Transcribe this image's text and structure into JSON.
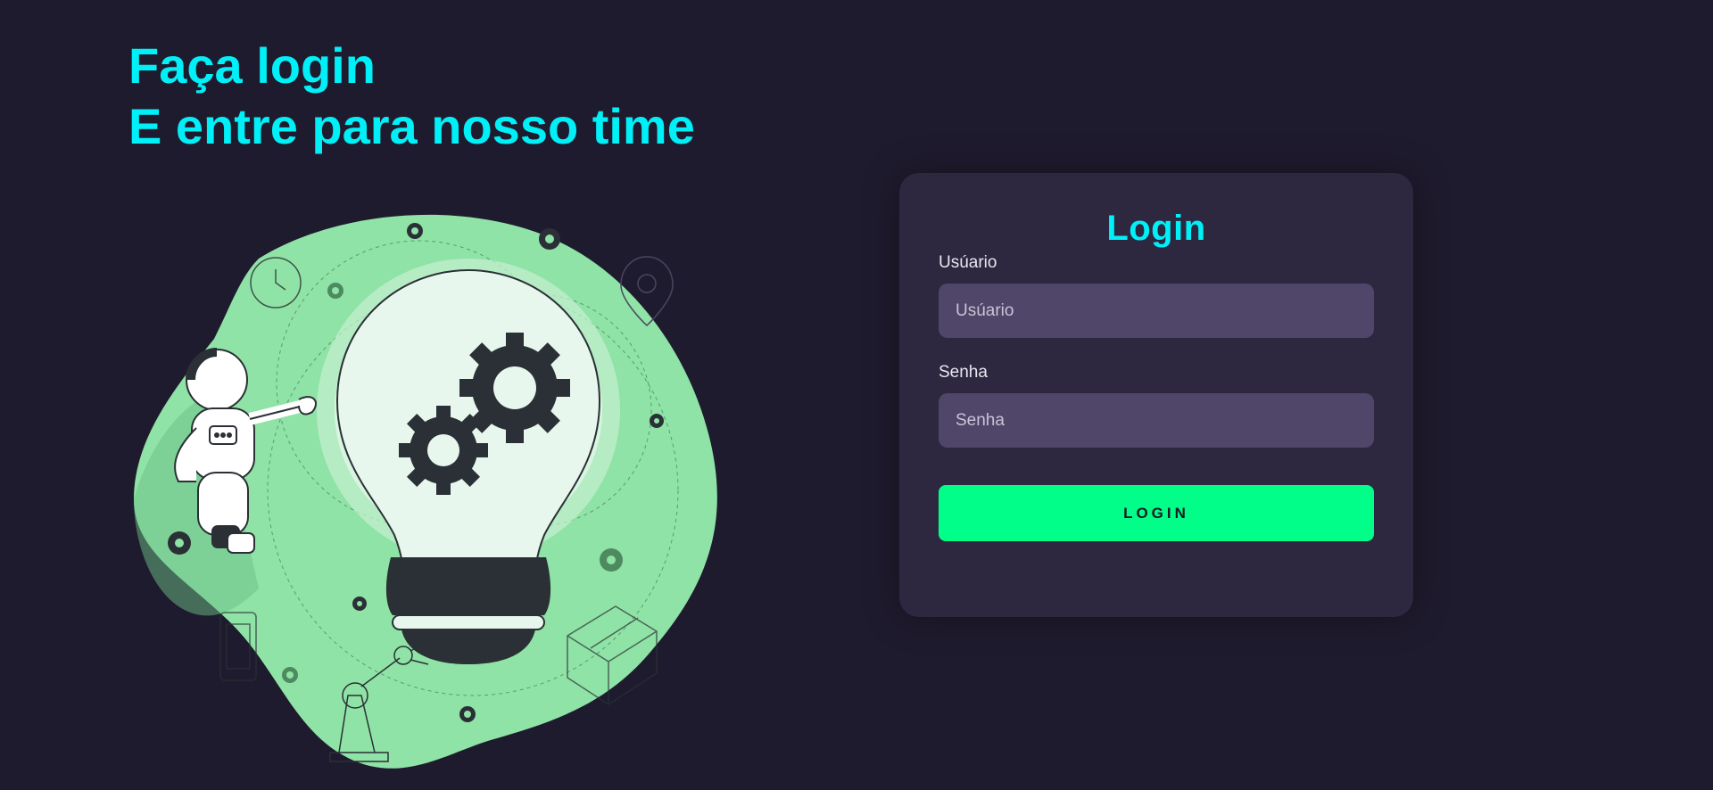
{
  "hero": {
    "line1": "Faça login",
    "line2": "E entre para nosso time"
  },
  "login_card": {
    "title": "Login",
    "username": {
      "label": "Usúario",
      "placeholder": "Usúario",
      "value": ""
    },
    "password": {
      "label": "Senha",
      "placeholder": "Senha",
      "value": ""
    },
    "submit_label": "LOGIN"
  },
  "illustration": {
    "subject": "astronaut-with-lightbulb-and-gears",
    "icons": [
      "gear-icon",
      "lightbulb-icon",
      "astronaut-icon",
      "clock-icon",
      "map-pin-icon",
      "smartphone-icon",
      "robot-arm-icon",
      "box-icon"
    ]
  },
  "colors": {
    "background": "#1f1b2e",
    "accent_cyan": "#00f0f8",
    "card": "#2d2840",
    "input": "#4f4669",
    "button": "#00fe88",
    "blob_green": "#8fe3a6"
  }
}
